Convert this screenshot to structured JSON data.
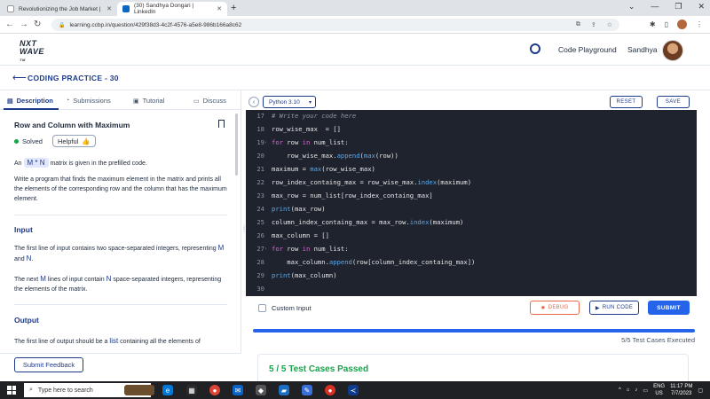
{
  "browser": {
    "tabs": [
      {
        "label": "Revolutionizing the Job Market |",
        "fav_color": "#ffffff"
      },
      {
        "label": "(30) Sandhya Dongari | LinkedIn",
        "fav_color": "#0a66c2"
      }
    ],
    "new_tab": "+",
    "url": "learning.ccbp.in/question/429f38d3-4c2f-4576-a5e8-986b166a8c62"
  },
  "header": {
    "logo_line1": "NXT",
    "logo_line2": "WAVE",
    "logo_tm": "TM",
    "code_playground": "Code Playground",
    "user_name": "Sandhya"
  },
  "practice": {
    "title": "CODING PRACTICE - 30"
  },
  "left_tabs": [
    {
      "label": "Description",
      "icon": "description-icon"
    },
    {
      "label": "Submissions",
      "icon": "submissions-icon"
    },
    {
      "label": "Tutorial",
      "icon": "tutorial-icon"
    },
    {
      "label": "Discuss",
      "icon": "discuss-icon"
    }
  ],
  "question": {
    "title": "Row and Column with Maximum",
    "solved": "Solved",
    "helpful": "Helpful",
    "intro_pre": "An",
    "intro_chip": "M * N",
    "intro_post": "matrix is given in the prefilled code.",
    "task": "Write a program that finds the maximum element in the matrix and prints all the elements of the corresponding row and the column that has the maximum element.",
    "input_heading": "Input",
    "input_p1_pre": "The first line of input contains two space-separated integers, representing",
    "input_p1_m": "M",
    "input_p1_and": "and",
    "input_p1_n": "N",
    "input_p1_end": ".",
    "input_p2_pre": "The next",
    "input_p2_m": "M",
    "input_p2_mid": "lines of input contain",
    "input_p2_n": "N",
    "input_p2_post": "space-separated integers, representing the elements of the matrix.",
    "output_heading": "Output",
    "output_p1_pre": "The first line of output should be a",
    "output_p1_list": "list",
    "output_p1_post": "containing all the elements of"
  },
  "feedback_label": "Submit Feedback",
  "editor": {
    "language": "Python 3.10",
    "reset": "RESET",
    "save": "SAVE",
    "lines": [
      {
        "n": "17",
        "fold": false,
        "html": "<span class=\"cm\"># Write your code here</span>"
      },
      {
        "n": "18",
        "fold": false,
        "html": "row_wise_max  = []"
      },
      {
        "n": "19",
        "fold": true,
        "html": "<span class=\"kw\">for</span> row <span class=\"kw\">in</span> num_list:"
      },
      {
        "n": "20",
        "fold": false,
        "html": "    row_wise_max.<span class=\"fn\">append</span>(<span class=\"fn\">max</span>(row))"
      },
      {
        "n": "21",
        "fold": false,
        "html": "maximum = <span class=\"fn\">max</span>(row_wise_max)"
      },
      {
        "n": "22",
        "fold": false,
        "html": "row_index_containg_max = row_wise_max.<span class=\"fn\">index</span>(maximum)"
      },
      {
        "n": "23",
        "fold": false,
        "html": "max_row = num_list[row_index_containg_max]"
      },
      {
        "n": "24",
        "fold": false,
        "html": "<span class=\"fn\">print</span>(max_row)"
      },
      {
        "n": "25",
        "fold": false,
        "html": "column_index_containg_max = max_row.<span class=\"fn\">index</span>(maximum)"
      },
      {
        "n": "26",
        "fold": false,
        "html": "max_column = []"
      },
      {
        "n": "27",
        "fold": true,
        "html": "<span class=\"kw\">for</span> row <span class=\"kw\">in</span> num_list:"
      },
      {
        "n": "28",
        "fold": false,
        "html": "    max_column.<span class=\"fn\">append</span>(row[column_index_containg_max])"
      },
      {
        "n": "29",
        "fold": false,
        "html": "<span class=\"fn\">print</span>(max_column)"
      },
      {
        "n": "30",
        "fold": false,
        "html": ""
      }
    ]
  },
  "run_bar": {
    "custom_input": "Custom Input",
    "debug": "DEBUG",
    "run_code": "RUN CODE",
    "submit": "SUBMIT"
  },
  "results": {
    "progress_fraction": 1.0,
    "executed": "5/5 Test Cases Executed",
    "passed": "5 / 5 Test Cases Passed"
  },
  "taskbar": {
    "search_placeholder": "Type here to search",
    "lang": "ENG",
    "region": "US",
    "time": "11:17 PM",
    "date": "7/7/2023"
  },
  "colors": {
    "brand_blue": "#1e3a8a",
    "submit_blue": "#2563eb",
    "success_green": "#16a34a",
    "debug_orange": "#e8694a",
    "editor_bg": "#1e232e"
  }
}
